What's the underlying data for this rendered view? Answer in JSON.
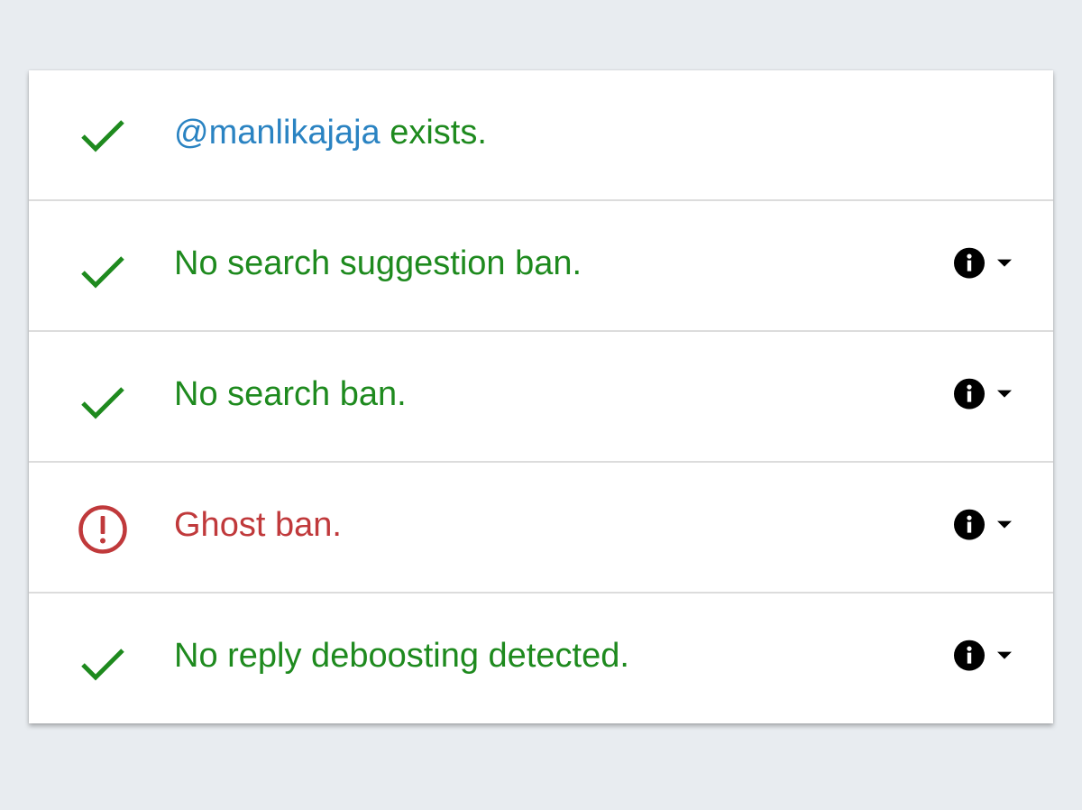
{
  "checks": [
    {
      "status": "pass",
      "icon": "checkmark-icon",
      "handle": "@manlikajaja",
      "text": " exists.",
      "has_details": false
    },
    {
      "status": "pass",
      "icon": "checkmark-icon",
      "text": "No search suggestion ban.",
      "has_details": true
    },
    {
      "status": "pass",
      "icon": "checkmark-icon",
      "text": "No search ban.",
      "has_details": true
    },
    {
      "status": "fail",
      "icon": "warning-circle-icon",
      "text": "Ghost ban.",
      "has_details": true
    },
    {
      "status": "pass",
      "icon": "checkmark-icon",
      "text": "No reply deboosting detected.",
      "has_details": true
    }
  ],
  "colors": {
    "pass": "#1e8a1e",
    "fail": "#c0393b",
    "handle": "#2a83c2",
    "background": "#e8ecf0"
  },
  "icons": {
    "info": "info-icon",
    "expand": "chevron-down-icon"
  }
}
